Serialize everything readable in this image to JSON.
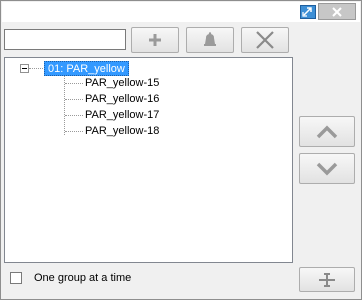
{
  "window": {
    "detach_icon": "detach-window-icon",
    "close_icon": "close-icon"
  },
  "toolbar": {
    "search": {
      "value": "",
      "placeholder": ""
    },
    "add_icon": "plus-icon",
    "bell_icon": "bell-icon",
    "delete_icon": "x-icon"
  },
  "tree": {
    "root": {
      "label": "01: PAR_yellow",
      "expanded": true,
      "selected": true
    },
    "children": [
      {
        "label": "PAR_yellow-15"
      },
      {
        "label": "PAR_yellow-16"
      },
      {
        "label": "PAR_yellow-17"
      },
      {
        "label": "PAR_yellow-18"
      }
    ]
  },
  "side_buttons": {
    "up_icon": "chevron-up-icon",
    "down_icon": "chevron-down-icon"
  },
  "footer": {
    "one_group_label": "One group at a time",
    "one_group_checked": false,
    "bottom_icon": "split-icon"
  },
  "colors": {
    "selection": "#3399ff",
    "icon_gray": "#9a9a9a",
    "close_bg": "#c7c7c7"
  }
}
